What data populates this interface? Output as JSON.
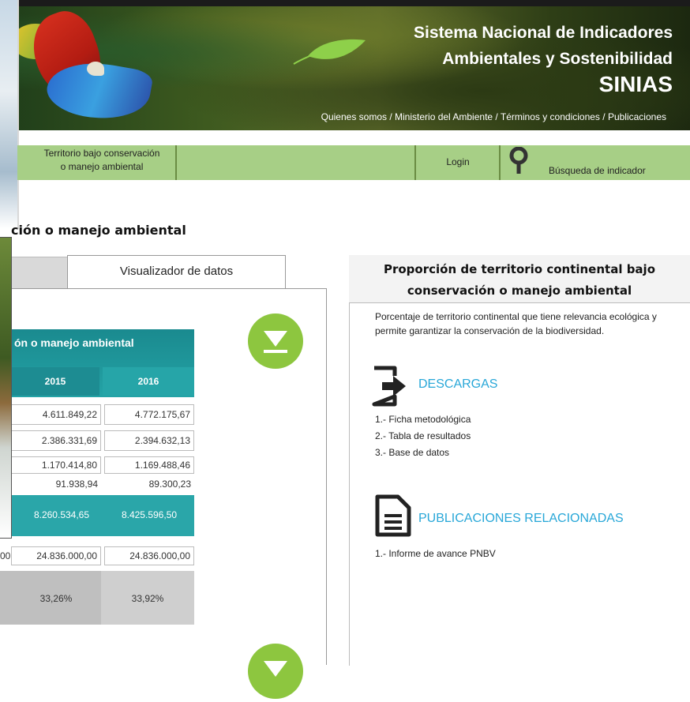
{
  "header": {
    "title_line1": "Sistema Nacional de Indicadores",
    "title_line2": "Ambientales y Sostenibilidad",
    "title_line3": "SINIAS",
    "links": [
      "Quienes somos",
      "Ministerio del Ambiente",
      "Términos y condiciones",
      "Publicaciones"
    ],
    "link_separator": " / "
  },
  "nav": {
    "territorio_line1": "Territorio bajo conservación",
    "territorio_line2": "o manejo ambiental",
    "login": "Login",
    "search": "Búsqueda de indicador"
  },
  "page_title": "ción o manejo ambiental",
  "tabs": {
    "active_label": "Visualizador de datos"
  },
  "table": {
    "title": "ón o manejo ambiental",
    "columns": [
      "2015",
      "2016"
    ],
    "rows": [
      [
        "4.611.849,22",
        "4.772.175,67"
      ],
      [
        "2.386.331,69",
        "2.394.632,13"
      ],
      [
        "1.170.414,80",
        "1.169.488,46"
      ],
      [
        "91.938,94",
        "89.300,23"
      ]
    ],
    "total": [
      "8.260.534,65",
      "8.425.596,50"
    ],
    "area_partial": "00",
    "area": [
      "24.836.000,00",
      "24.836.000,00"
    ],
    "percent": [
      "33,26%",
      "33,92%"
    ]
  },
  "info": {
    "title_line1": "Proporción de territorio continental bajo",
    "title_line2": "conservación o manejo ambiental",
    "description": "Porcentaje de territorio continental que tiene relevancia ecológica y permite garantizar la conservación de la biodiversidad.",
    "downloads_title": "DESCARGAS",
    "downloads": [
      "1.- Ficha metodológica",
      "2.- Tabla de resultados",
      "3.- Base de datos"
    ],
    "publications_title": "PUBLICACIONES RELACIONADAS",
    "publications": [
      "1.- Informe de avance PNBV"
    ]
  },
  "colors": {
    "nav_green": "#a7cf86",
    "teal": "#26a5a8",
    "accent_blue": "#28a7d8",
    "download_green": "#8dc63f"
  },
  "icons": [
    "leaf-icon",
    "pin-icon",
    "download-arrow-icon",
    "descargas-icon",
    "document-icon"
  ]
}
